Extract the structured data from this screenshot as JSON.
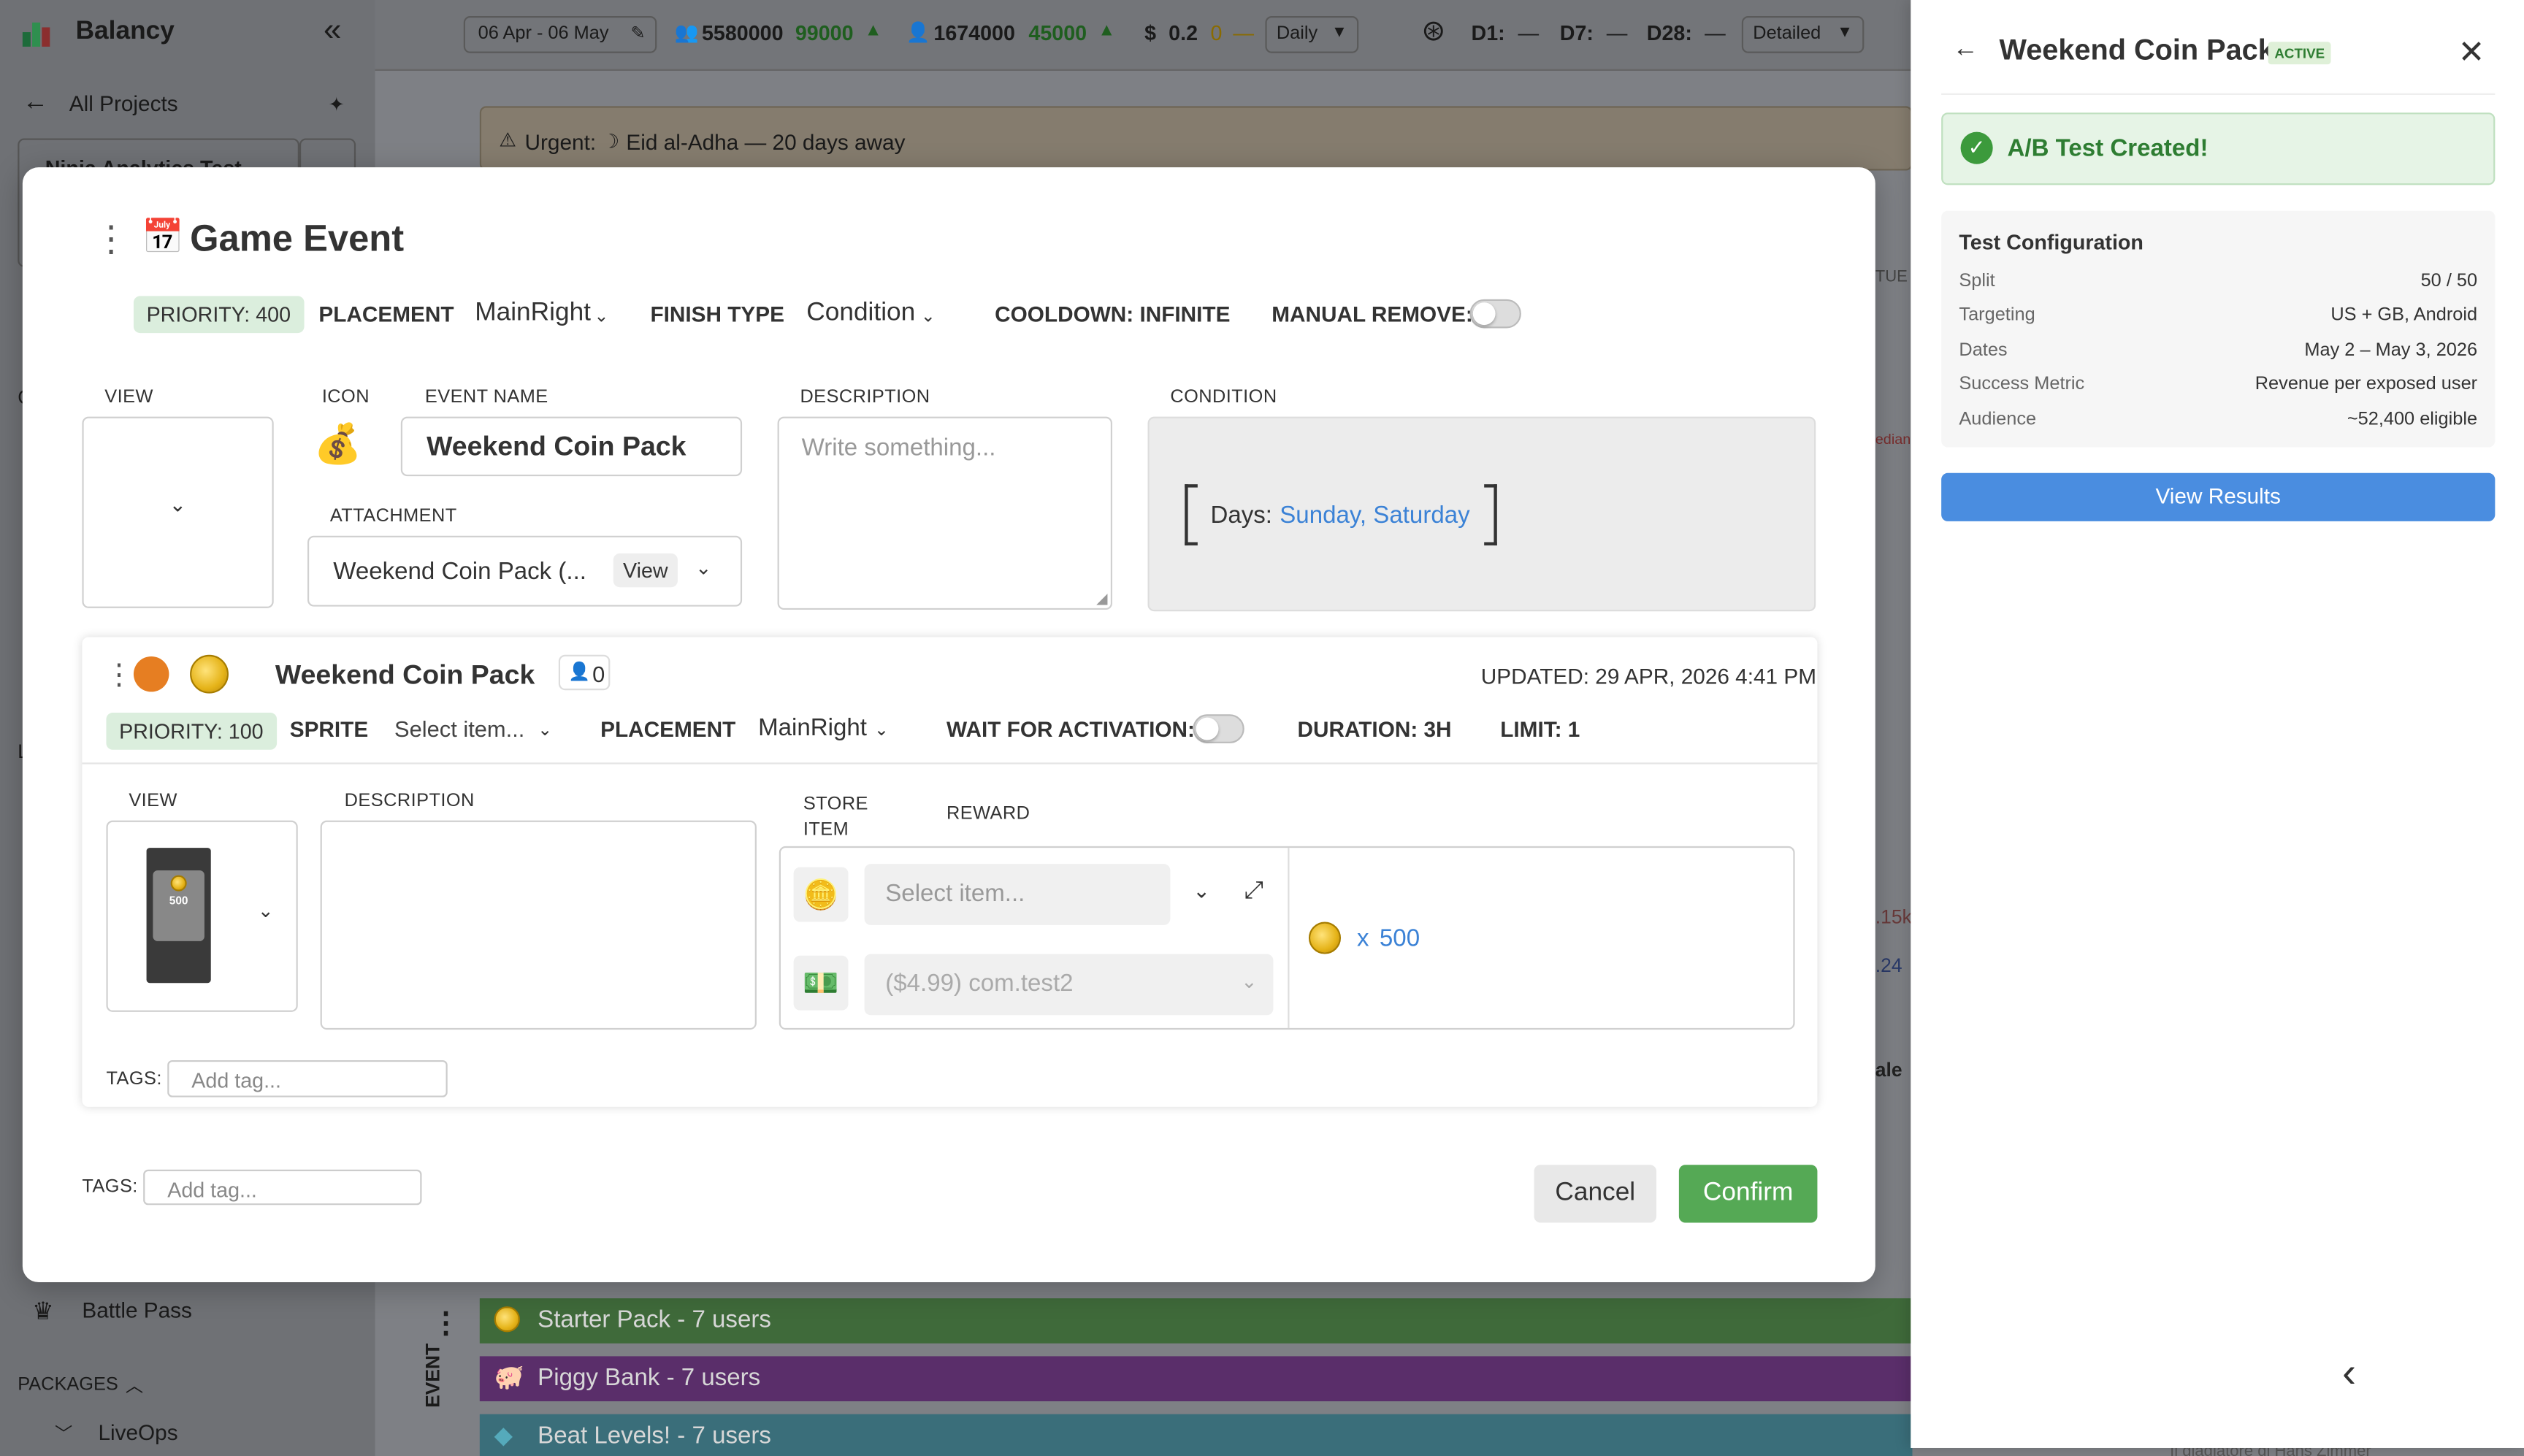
{
  "app": {
    "name": "Balancy",
    "all_projects": "All Projects",
    "project_name": "Ninja Analytics Test"
  },
  "topbar": {
    "date_range": "06 Apr - 06 May",
    "users_total": "5580000",
    "users_delta": "99000",
    "new_users": "1674000",
    "new_users_delta": "45000",
    "revenue_symbol": "$",
    "revenue": "0.2",
    "revenue_delta": "0",
    "period": "Daily",
    "d1": "D1:",
    "d1_val": "—",
    "d7": "D7:",
    "d7_val": "—",
    "d28": "D28:",
    "d28_val": "—",
    "mode": "Detailed"
  },
  "banner": {
    "text": "Urgent:",
    "event": "Eid al-Adha — 20 days away"
  },
  "sidebar": {
    "battle_pass": "Battle Pass",
    "packages": "PACKAGES",
    "liveops": "LiveOps",
    "left_hint": "L",
    "c_hint": "C"
  },
  "bg_labels": {
    "tue": "TUE",
    "median": "edian",
    "v1": ".15k",
    "v2": ".24",
    "sale": "ale"
  },
  "bottom_bars": {
    "event_label": "EVENT",
    "starter": "Starter Pack - 7 users",
    "piggy": "Piggy Bank - 7 users",
    "beat": "Beat Levels! - 7 users",
    "bottom_text": "Il gladiatore di Hans Zimmer"
  },
  "modal": {
    "title": "Game Event",
    "emoji": "📅",
    "priority": "PRIORITY: 400",
    "placement_label": "PLACEMENT",
    "placement_value": "MainRight",
    "finish_label": "FINISH TYPE",
    "finish_value": "Condition",
    "cooldown": "COOLDOWN: INFINITE",
    "manual_remove": "MANUAL REMOVE:",
    "view_label": "VIEW",
    "icon_label": "ICON",
    "event_name_label": "EVENT NAME",
    "event_name": "Weekend Coin Pack",
    "description_label": "DESCRIPTION",
    "description_placeholder": "Write something...",
    "condition_label": "CONDITION",
    "condition_days_label": "Days:",
    "condition_days_value": "Sunday, Saturday",
    "attachment_label": "ATTACHMENT",
    "attachment_value": "Weekend Coin Pack (...",
    "attachment_view": "View",
    "tags_label": "TAGS:",
    "tags_placeholder": "Add tag...",
    "cancel": "Cancel",
    "confirm": "Confirm"
  },
  "offer": {
    "name": "Weekend Coin Pack",
    "user_count": "0",
    "updated": "UPDATED: 29 APR, 2026 4:41 PM",
    "priority": "PRIORITY: 100",
    "sprite_label": "SPRITE",
    "sprite_value": "Select item...",
    "placement_label": "PLACEMENT",
    "placement_value": "MainRight",
    "wait_label": "WAIT FOR ACTIVATION:",
    "duration": "DURATION: 3H",
    "limit": "LIMIT: 1",
    "view_label": "VIEW",
    "description_label": "DESCRIPTION",
    "store_item_label": "STORE ITEM",
    "reward_label": "REWARD",
    "select_item_placeholder": "Select item...",
    "price_value": "($4.99) com.test2",
    "reward_x": "x",
    "reward_amount": "500",
    "thumb_amount": "500",
    "tags_label": "TAGS:",
    "tags_placeholder": "Add tag..."
  },
  "panel": {
    "title": "Weekend Coin Pack",
    "badge": "ACTIVE",
    "success": "A/B Test Created!",
    "config_title": "Test Configuration",
    "rows": [
      {
        "k": "Split",
        "v": "50 / 50"
      },
      {
        "k": "Targeting",
        "v": "US + GB, Android"
      },
      {
        "k": "Dates",
        "v": "May 2 – May 3, 2026"
      },
      {
        "k": "Success Metric",
        "v": "Revenue per exposed user"
      },
      {
        "k": "Audience",
        "v": "~52,400 eligible"
      }
    ],
    "view_results": "View Results"
  },
  "colors": {
    "accent_green": "#55a955",
    "link_blue": "#3b82d6",
    "panel_button": "#4a8de0",
    "success_bg": "#e6f4e6"
  }
}
